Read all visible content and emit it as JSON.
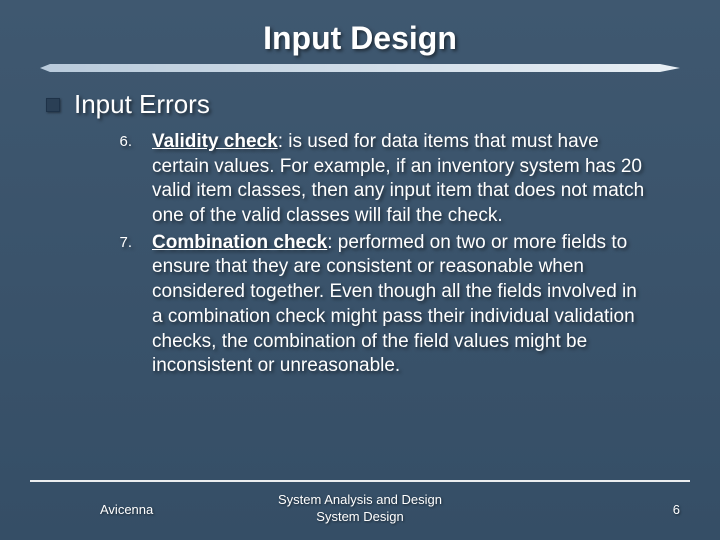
{
  "title": "Input Design",
  "subtitle": "Input Errors",
  "items": [
    {
      "num": "6.",
      "term": "Validity check",
      "rest": ": is used for data items that must have certain values. For example, if an inventory system has 20 valid item classes, then any input item that does not match one of the valid classes will fail the check."
    },
    {
      "num": "7.",
      "term": "Combination check",
      "rest": ": performed on two or more fields to ensure that they are consistent or reasonable when considered together. Even though all the fields involved in a combination check might pass their individual validation checks, the combination of the field values might be inconsistent or unreasonable."
    }
  ],
  "footer": {
    "left": "Avicenna",
    "center_line1": "System Analysis and Design",
    "center_line2": "System Design",
    "right": "6"
  }
}
